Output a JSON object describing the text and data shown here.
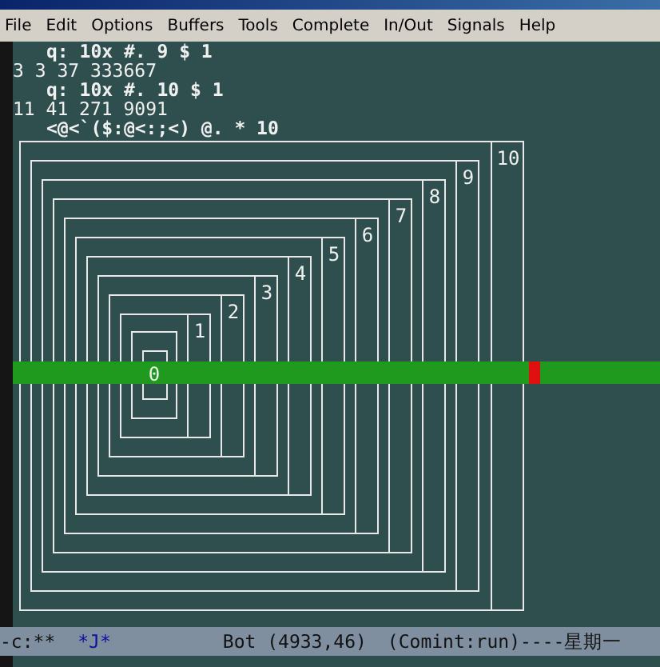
{
  "menu": [
    "File",
    "Edit",
    "Options",
    "Buffers",
    "Tools",
    "Complete",
    "In/Out",
    "Signals",
    "Help"
  ],
  "lines": [
    {
      "kind": "input",
      "text": "q: 10x #. 9 $ 1"
    },
    {
      "kind": "output",
      "text": "3 3 37 333667"
    },
    {
      "kind": "input",
      "text": "q: 10x #. 10 $ 1"
    },
    {
      "kind": "output",
      "text": "11 41 271 9091"
    },
    {
      "kind": "input",
      "text": "<@<`($:@<:;<) @. * 10"
    }
  ],
  "boxes": [
    {
      "label": "0"
    },
    {
      "label": "1"
    },
    {
      "label": "2"
    },
    {
      "label": "3"
    },
    {
      "label": "4"
    },
    {
      "label": "5"
    },
    {
      "label": "6"
    },
    {
      "label": "7"
    },
    {
      "label": "8"
    },
    {
      "label": "9"
    },
    {
      "label": "10"
    }
  ],
  "mode_line": {
    "flags": "-c:**",
    "buffer": "*J*",
    "position": "Bot (4933,46)",
    "mode": "(Comint:run)----星期一"
  }
}
